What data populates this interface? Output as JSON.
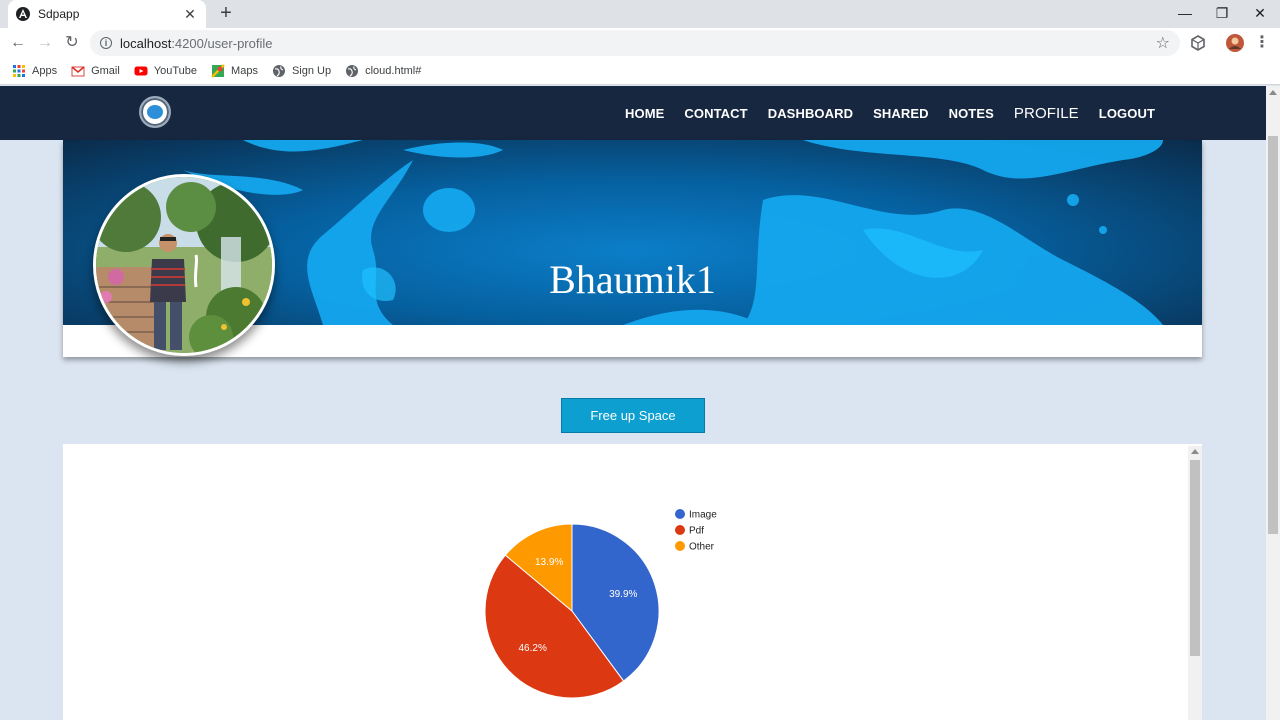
{
  "browser": {
    "tab_title": "Sdpapp",
    "tab_close": "✕",
    "new_tab": "+",
    "window_controls": {
      "minimize": "—",
      "restore": "❐",
      "close": "✕"
    },
    "nav": {
      "back": "←",
      "forward": "→",
      "reload": "↻"
    },
    "url": {
      "host": "localhost",
      "path": ":4200/user-profile"
    },
    "bookmarks": [
      {
        "label": "Apps",
        "icon": "apps-grid-icon"
      },
      {
        "label": "Gmail",
        "icon": "gmail-icon"
      },
      {
        "label": "YouTube",
        "icon": "youtube-icon"
      },
      {
        "label": "Maps",
        "icon": "maps-icon"
      },
      {
        "label": "Sign Up",
        "icon": "globe-icon"
      },
      {
        "label": "cloud.html#",
        "icon": "globe-icon"
      }
    ]
  },
  "navbar": {
    "links": [
      "HOME",
      "CONTACT",
      "DASHBOARD",
      "SHARED",
      "NOTES",
      "PROFILE",
      "LOGOUT"
    ],
    "active": "PROFILE"
  },
  "profile": {
    "username": "Bhaumik1"
  },
  "actions": {
    "free_up_label": "Free up Space"
  },
  "colors": {
    "navbar": "#172740",
    "banner": "#0b7ec9",
    "button": "#0e9fd1",
    "page_bg": "#dbe5f1"
  },
  "chart_data": {
    "type": "pie",
    "title": "",
    "legend_position": "right",
    "series": [
      {
        "name": "Image",
        "value": 39.9,
        "label": "39.9%",
        "color": "#3366cc"
      },
      {
        "name": "Pdf",
        "value": 46.2,
        "label": "46.2%",
        "color": "#dc3912"
      },
      {
        "name": "Other",
        "value": 13.9,
        "label": "13.9%",
        "color": "#ff9900"
      }
    ]
  }
}
